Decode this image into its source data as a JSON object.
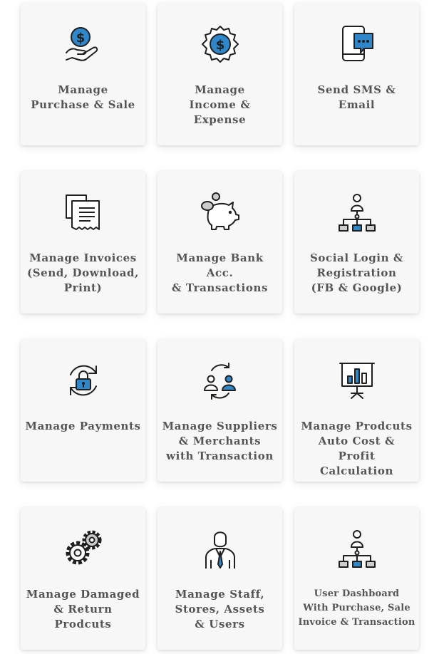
{
  "colors": {
    "accent": "#2f86c9",
    "stroke": "#1f1f1f",
    "text": "#555555",
    "card": "#f7f7f7"
  },
  "features": [
    {
      "label": "Manage\nPurchase & Sale",
      "icon": "dollar-hand-icon"
    },
    {
      "label": "Manage\nIncome & Expense",
      "icon": "dollar-badge-icon"
    },
    {
      "label": "Send SMS & Email",
      "icon": "phone-chat-icon"
    },
    {
      "label": "Manage Invoices\n(Send, Download,\nPrint)",
      "icon": "invoice-icon"
    },
    {
      "label": "Manage Bank Acc.\n& Transactions",
      "icon": "piggy-bank-icon"
    },
    {
      "label": "Social Login &\nRegistration\n(FB & Google)",
      "icon": "org-chart-icon"
    },
    {
      "label": "Manage Payments",
      "icon": "lock-refresh-icon"
    },
    {
      "label": "Manage Suppliers\n& Merchants\nwith Transaction",
      "icon": "users-exchange-icon"
    },
    {
      "label": "Manage Prodcuts\nAuto Cost & Profit\nCalculation",
      "icon": "presentation-chart-icon"
    },
    {
      "label": "Manage Damaged\n& Return Prodcuts",
      "icon": "gears-icon"
    },
    {
      "label": "Manage Staff,\nStores, Assets\n& Users",
      "icon": "businessman-icon"
    },
    {
      "label": "User Dashboard\nWith Purchase, Sale\nInvoice & Transaction",
      "icon": "org-chart-icon"
    }
  ]
}
